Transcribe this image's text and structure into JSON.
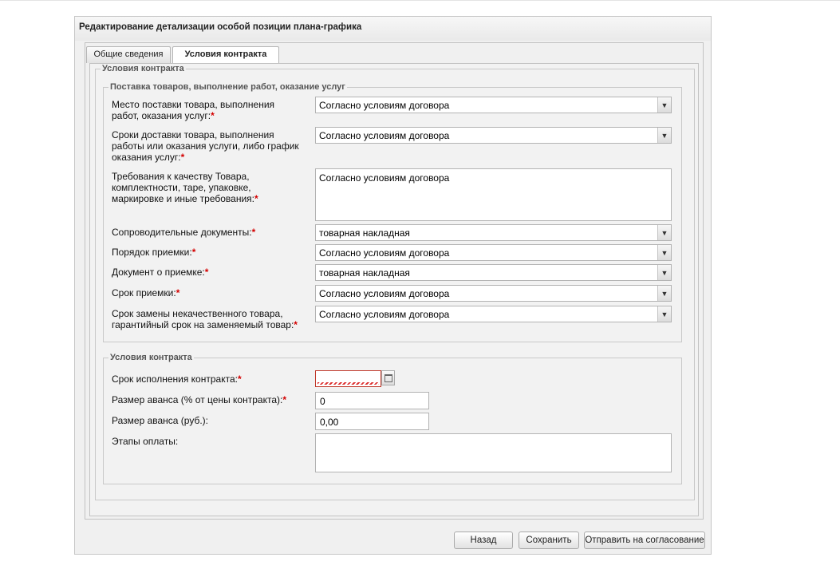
{
  "window": {
    "title": "Редактирование детализации особой позиции плана-графика"
  },
  "tabs": [
    {
      "label": "Общие сведения",
      "active": false
    },
    {
      "label": "Условия контракта",
      "active": true
    }
  ],
  "contract_terms": {
    "legend": "Условия контракта",
    "delivery": {
      "legend": "Поставка товаров, выполнение работ, оказание услуг",
      "place": {
        "label_lines": [
          "Место поставки товара, выполнения",
          "работ, оказания услуг:"
        ],
        "value": "Согласно условиям договора"
      },
      "terms": {
        "label_lines": [
          "Сроки доставки товара, выполнения",
          "работы или оказания услуги, либо график",
          "оказания услуг:"
        ],
        "value": "Согласно условиям договора"
      },
      "quality": {
        "label_lines": [
          "Требования к качеству Товара,",
          "комплектности, таре, упаковке,",
          "маркировке и иные требования:"
        ],
        "value": "Согласно условиям договора"
      },
      "documents": {
        "label": "Сопроводительные документы:",
        "value": "товарная накладная"
      },
      "acceptance_order": {
        "label": "Порядок приемки:",
        "value": "Согласно условиям договора"
      },
      "acceptance_doc": {
        "label": "Документ о приемке:",
        "value": "товарная накладная"
      },
      "acceptance_term": {
        "label": "Срок приемки:",
        "value": "Согласно условиям договора"
      },
      "replacement": {
        "label_lines": [
          "Срок замены некачественного товара,",
          "гарантийный срок на заменяемый товар:"
        ],
        "value": "Согласно условиям договора"
      }
    },
    "contract": {
      "legend": "Условия контракта",
      "execution_term": {
        "label": "Срок исполнения контракта:",
        "value": ""
      },
      "advance_percent": {
        "label": "Размер аванса (% от цены контракта):",
        "value": "0"
      },
      "advance_rub": {
        "label": "Размер аванса (руб.):",
        "value": "0,00"
      },
      "payment_stages": {
        "label": "Этапы оплаты:",
        "value": ""
      }
    }
  },
  "required_mark": "*",
  "buttons": {
    "back": "Назад",
    "save": "Сохранить",
    "send": "Отправить на согласование"
  }
}
